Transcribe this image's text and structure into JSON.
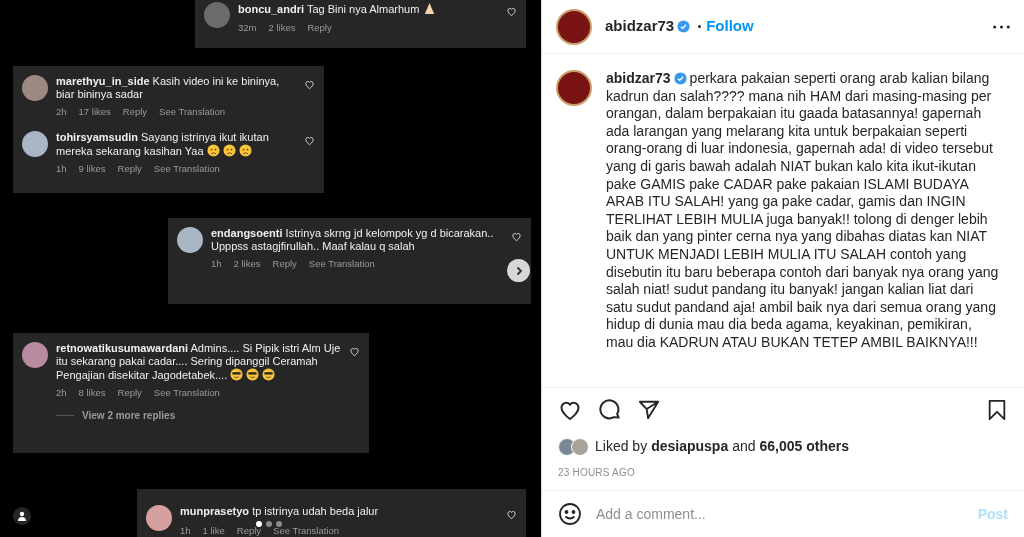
{
  "media": {
    "cards": [
      {
        "comments": [
          {
            "user": "boncu_andri",
            "text": "Tag Bini nya Almarhum",
            "icons": [
              {
                "kind": "pray"
              }
            ],
            "meta": [
              "32m",
              "2 likes",
              "Reply"
            ]
          }
        ]
      },
      {
        "comments": [
          {
            "user": "marethyu_in_side",
            "text": "Kasih video ini ke bininya, biar bininya sadar",
            "meta": [
              "2h",
              "17 likes",
              "Reply",
              "See Translation"
            ]
          },
          {
            "user": "tohirsyamsudin",
            "text": "Sayang istrinya ikut ikutan mereka sekarang kasihan Yaa",
            "icons": [
              {
                "kind": "sad"
              },
              {
                "kind": "sad"
              },
              {
                "kind": "sad"
              }
            ],
            "meta": [
              "1h",
              "9 likes",
              "Reply",
              "See Translation"
            ]
          }
        ]
      },
      {
        "comments": [
          {
            "user": "endangsoenti",
            "text": "Istrinya skrng jd kelompok yg d bicarakan.. Upppss astagjfirullah.. Maaf kalau q salah",
            "meta": [
              "1h",
              "2 likes",
              "Reply",
              "See Translation"
            ]
          }
        ]
      },
      {
        "comments": [
          {
            "user": "retnowatikusumawardani",
            "text": "Admins.... Si Pipik istri Alm Uje itu sekarang pakai cadar.... Sering dipanggil Ceramah Pengajian disekitar Jagodetabek....",
            "icons": [
              {
                "kind": "cool"
              },
              {
                "kind": "cool"
              },
              {
                "kind": "cool"
              }
            ],
            "meta": [
              "2h",
              "8 likes",
              "Reply",
              "See Translation"
            ]
          }
        ],
        "more_replies": "View 2 more replies"
      },
      {
        "comments": [
          {
            "user": "munprasetyo",
            "text": "tp istrinya udah beda jalur",
            "meta": [
              "1h",
              "1 like",
              "Reply",
              "See Translation"
            ]
          }
        ]
      }
    ],
    "dots": [
      {
        "selected": true
      },
      {
        "selected": false
      },
      {
        "selected": false
      }
    ]
  },
  "post": {
    "header": {
      "user": "abidzar73",
      "verified": true,
      "follow": "Follow"
    },
    "caption": {
      "user": "abidzar73",
      "verified": true,
      "text": "perkara pakaian seperti orang arab kalian bilang kadrun dan salah???? mana nih HAM dari masing-masing per orangan, dalam berpakaian itu gaada batasannya! gapernah ada larangan yang melarang kita untuk berpakaian seperti orang-orang di luar indonesia, gapernah ada! di video tersebut yang di garis bawah adalah NIAT bukan kalo kita ikut-ikutan pake GAMIS pake CADAR pake pakaian ISLAMI BUDAYA ARAB ITU SALAH! yang ga pake cadar, gamis dan INGIN TERLIHAT LEBIH MULIA juga banyak!! tolong di denger lebih baik dan yang pinter cerna nya yang dibahas diatas kan NIAT UNTUK MENJADI LEBIH MULIA ITU SALAH contoh yang disebutin itu baru beberapa contoh dari banyak nya orang yang salah niat! sudut pandang itu banyak! jangan kalian liat dari satu sudut pandand aja! ambil baik nya dari semua orang yang hidup di dunia mau dia beda agama, keyakinan, pemikiran, mau dia KADRUN ATAU BUKAN TETEP AMBIL BAIKNYA!!!"
    },
    "likes": {
      "prefix": "Liked by",
      "user": "desiapuspa",
      "middle": "and",
      "count": "66,005 others"
    },
    "time": "23 HOURS AGO",
    "comment_box": {
      "placeholder": "Add a comment...",
      "post": "Post"
    }
  }
}
